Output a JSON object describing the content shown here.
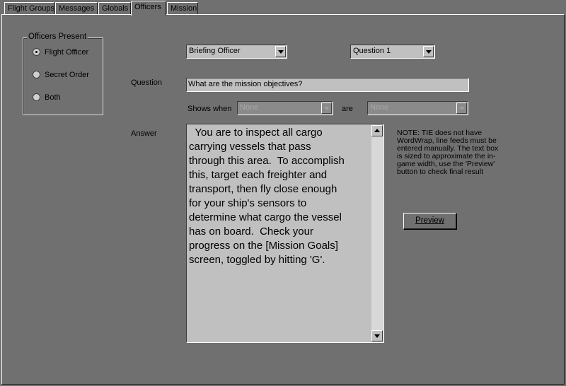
{
  "tabs": [
    {
      "label": "Flight Groups"
    },
    {
      "label": "Messages"
    },
    {
      "label": "Globals"
    },
    {
      "label": "Officers"
    },
    {
      "label": "Mission"
    }
  ],
  "officers_group": {
    "title": "Officers Present",
    "options": [
      {
        "label": "Flight Officer",
        "checked": true
      },
      {
        "label": "Secret Order",
        "checked": false
      },
      {
        "label": "Both",
        "checked": false
      }
    ]
  },
  "officer_select": {
    "value": "Briefing Officer"
  },
  "question_select": {
    "value": "Question 1"
  },
  "question": {
    "label": "Question",
    "value": "What are the mission objectives?"
  },
  "shows_when": {
    "label": "Shows when",
    "value1": "None",
    "connector": "are",
    "value2": "None"
  },
  "answer": {
    "label": "Answer",
    "text": "  You are to inspect all cargo\ncarrying vessels that pass\nthrough this area.  To accomplish\nthis, target each freighter and\ntransport, then fly close enough\nfor your ship's sensors to\ndetermine what cargo the vessel\nhas on board.  Check your\nprogress on the [Mission Goals]\nscreen, toggled by hitting 'G'."
  },
  "note": "NOTE: TIE does not have WordWrap, line feeds must be entered manually. The text box is sized to approximate the in-game width, use the 'Preview' button to check final result",
  "preview_button": {
    "label": "Preview"
  }
}
